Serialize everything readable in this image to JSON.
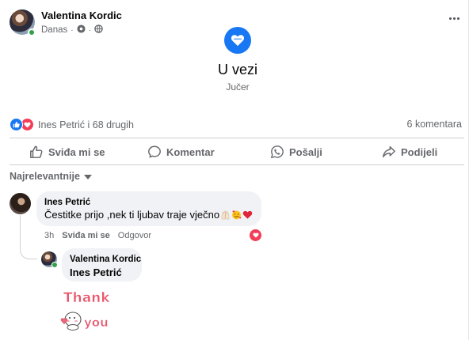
{
  "post": {
    "author": "Valentina Kordic",
    "time": "Danas",
    "meta_separator": "·"
  },
  "life_event": {
    "title": "U vezi",
    "date": "Jučer"
  },
  "reactions": {
    "summary": "Ines Petrić i 68 drugih",
    "types": [
      "like",
      "love"
    ]
  },
  "comments_count": "6 komentara",
  "actions": {
    "like": "Sviđa mi se",
    "comment": "Komentar",
    "send": "Pošalji",
    "share": "Podijeli"
  },
  "filter": {
    "label": "Najrelevantnije"
  },
  "comments": [
    {
      "author": "Ines Petrić",
      "text": "Čestitke prijo ,nek ti ljubav traje vječno",
      "emojis": [
        "raised-hands",
        "smiling-face-with-hearts",
        "red-heart"
      ],
      "time": "3h",
      "like_label": "Sviđa mi se",
      "reply_label": "Odgovor",
      "reaction": "love"
    }
  ],
  "reply": {
    "author": "Valentina Kordic",
    "mention": "Ines Petrić",
    "sticker": {
      "line1": "Thank",
      "line2": "you"
    }
  },
  "colors": {
    "accent": "#1877f2",
    "love": "#f33e58",
    "online": "#31a24c",
    "secondary_text": "#65676b",
    "bubble": "#f0f2f5",
    "sticker_text": "#e8566b"
  }
}
